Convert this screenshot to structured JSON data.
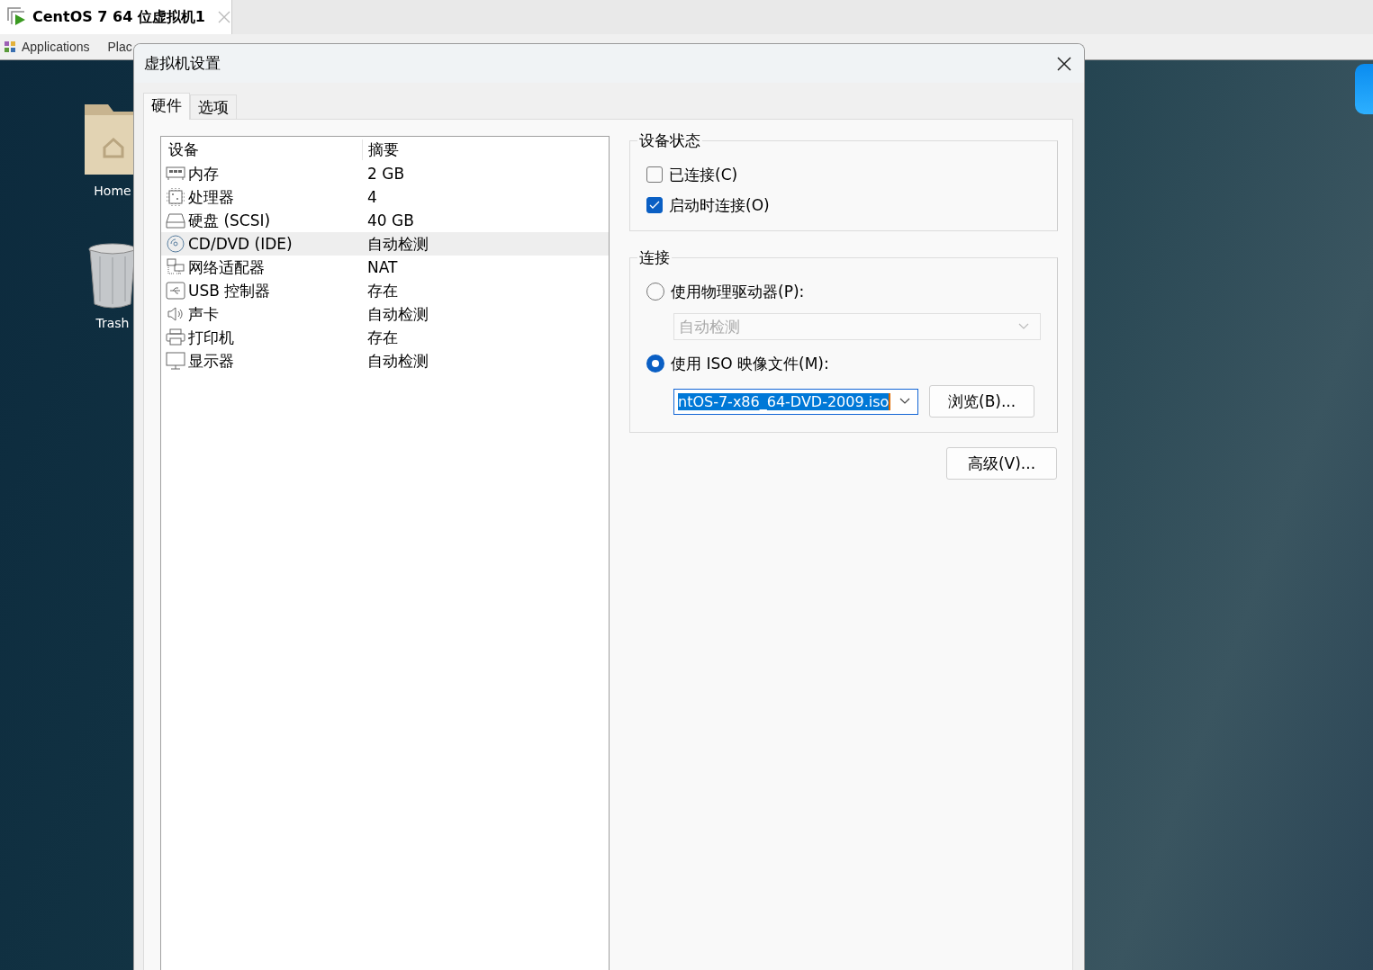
{
  "app_tab": {
    "title": "CentOS 7 64 位虚拟机1"
  },
  "top_bar": {
    "menus": [
      "Applications",
      "Plac"
    ]
  },
  "desktop_icons": [
    {
      "label": "Home",
      "kind": "folder"
    },
    {
      "label": "Trash",
      "kind": "trash"
    }
  ],
  "dialog": {
    "title": "虚拟机设置",
    "tabs": [
      {
        "label": "硬件",
        "selected": true
      },
      {
        "label": "选项",
        "selected": false
      }
    ],
    "device_table": {
      "columns": [
        "设备",
        "摘要"
      ],
      "rows": [
        {
          "kind": "memory",
          "device": "内存",
          "summary": "2 GB",
          "selected": false
        },
        {
          "kind": "processor",
          "device": "处理器",
          "summary": "4",
          "selected": false
        },
        {
          "kind": "disk",
          "device": "硬盘 (SCSI)",
          "summary": "40 GB",
          "selected": false
        },
        {
          "kind": "cdrom",
          "device": "CD/DVD (IDE)",
          "summary": "自动检测",
          "selected": true
        },
        {
          "kind": "network",
          "device": "网络适配器",
          "summary": "NAT",
          "selected": false
        },
        {
          "kind": "usb",
          "device": "USB 控制器",
          "summary": "存在",
          "selected": false
        },
        {
          "kind": "sound",
          "device": "声卡",
          "summary": "自动检测",
          "selected": false
        },
        {
          "kind": "printer",
          "device": "打印机",
          "summary": "存在",
          "selected": false
        },
        {
          "kind": "display",
          "device": "显示器",
          "summary": "自动检测",
          "selected": false
        }
      ]
    },
    "device_status": {
      "title": "设备状态",
      "options": [
        {
          "label": "已连接(C)",
          "checked": false
        },
        {
          "label": "启动时连接(O)",
          "checked": true
        }
      ]
    },
    "connection": {
      "title": "连接",
      "options": [
        {
          "kind": "drive",
          "label": "使用物理驱动器(P):",
          "selected": false,
          "field": {
            "value": "自动检测",
            "disabled": true
          }
        },
        {
          "kind": "iso",
          "label": "使用 ISO 映像文件(M):",
          "selected": true,
          "field": {
            "value": "ntOS-7-x86_64-DVD-2009.iso",
            "highlighted": true
          }
        }
      ],
      "browse_button": "浏览(B)..."
    },
    "advanced_button": "高级(V)..."
  }
}
